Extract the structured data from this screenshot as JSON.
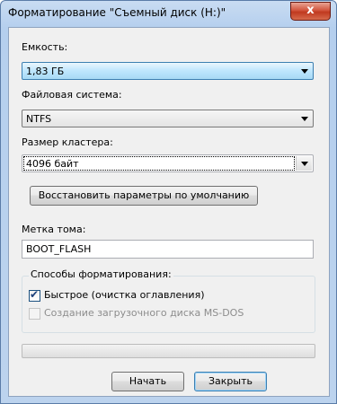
{
  "window": {
    "title": "Форматирование \"Съемный диск (H:)\"",
    "close_label": "x"
  },
  "capacity": {
    "label": "Емкость:",
    "value": "1,83 ГБ"
  },
  "filesystem": {
    "label": "Файловая система:",
    "value": "NTFS"
  },
  "cluster": {
    "label": "Размер кластера:",
    "value": "4096 байт"
  },
  "restore_defaults_label": "Восстановить параметры по умолчанию",
  "volume_label": {
    "label": "Метка тома:",
    "value": "BOOT_FLASH"
  },
  "format_options": {
    "title": "Способы форматирования:",
    "quick": {
      "label": "Быстрое (очистка оглавления)",
      "checked": true
    },
    "msdos": {
      "label": "Создание загрузочного диска MS-DOS",
      "checked": false,
      "disabled": true
    }
  },
  "progress": {
    "value": 0
  },
  "buttons": {
    "start": "Начать",
    "close": "Закрыть"
  },
  "colors": {
    "title_bar": "#b5cfee",
    "close_button": "#c0391f",
    "highlight_combo": "#bee6fd"
  }
}
